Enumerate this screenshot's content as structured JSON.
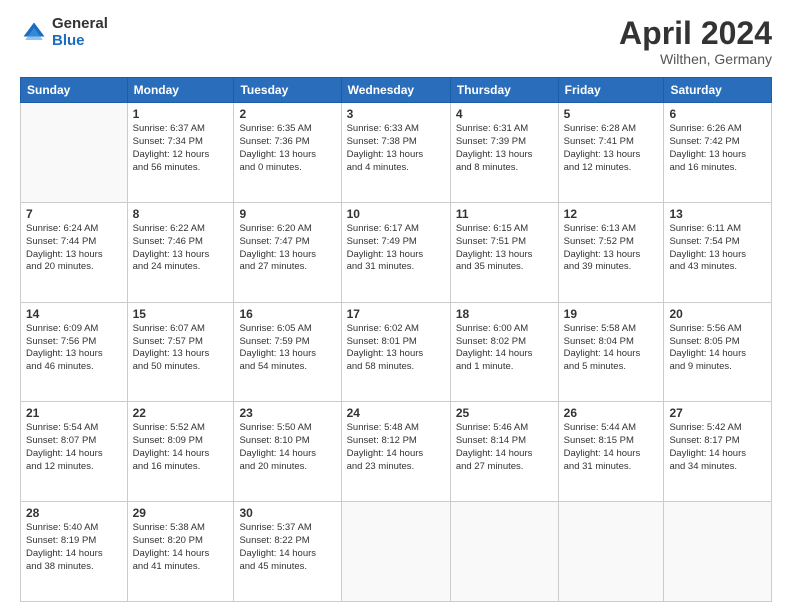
{
  "logo": {
    "general": "General",
    "blue": "Blue"
  },
  "title": "April 2024",
  "subtitle": "Wilthen, Germany",
  "days_of_week": [
    "Sunday",
    "Monday",
    "Tuesday",
    "Wednesday",
    "Thursday",
    "Friday",
    "Saturday"
  ],
  "weeks": [
    [
      {
        "day": "",
        "info": ""
      },
      {
        "day": "1",
        "info": "Sunrise: 6:37 AM\nSunset: 7:34 PM\nDaylight: 12 hours\nand 56 minutes."
      },
      {
        "day": "2",
        "info": "Sunrise: 6:35 AM\nSunset: 7:36 PM\nDaylight: 13 hours\nand 0 minutes."
      },
      {
        "day": "3",
        "info": "Sunrise: 6:33 AM\nSunset: 7:38 PM\nDaylight: 13 hours\nand 4 minutes."
      },
      {
        "day": "4",
        "info": "Sunrise: 6:31 AM\nSunset: 7:39 PM\nDaylight: 13 hours\nand 8 minutes."
      },
      {
        "day": "5",
        "info": "Sunrise: 6:28 AM\nSunset: 7:41 PM\nDaylight: 13 hours\nand 12 minutes."
      },
      {
        "day": "6",
        "info": "Sunrise: 6:26 AM\nSunset: 7:42 PM\nDaylight: 13 hours\nand 16 minutes."
      }
    ],
    [
      {
        "day": "7",
        "info": "Sunrise: 6:24 AM\nSunset: 7:44 PM\nDaylight: 13 hours\nand 20 minutes."
      },
      {
        "day": "8",
        "info": "Sunrise: 6:22 AM\nSunset: 7:46 PM\nDaylight: 13 hours\nand 24 minutes."
      },
      {
        "day": "9",
        "info": "Sunrise: 6:20 AM\nSunset: 7:47 PM\nDaylight: 13 hours\nand 27 minutes."
      },
      {
        "day": "10",
        "info": "Sunrise: 6:17 AM\nSunset: 7:49 PM\nDaylight: 13 hours\nand 31 minutes."
      },
      {
        "day": "11",
        "info": "Sunrise: 6:15 AM\nSunset: 7:51 PM\nDaylight: 13 hours\nand 35 minutes."
      },
      {
        "day": "12",
        "info": "Sunrise: 6:13 AM\nSunset: 7:52 PM\nDaylight: 13 hours\nand 39 minutes."
      },
      {
        "day": "13",
        "info": "Sunrise: 6:11 AM\nSunset: 7:54 PM\nDaylight: 13 hours\nand 43 minutes."
      }
    ],
    [
      {
        "day": "14",
        "info": "Sunrise: 6:09 AM\nSunset: 7:56 PM\nDaylight: 13 hours\nand 46 minutes."
      },
      {
        "day": "15",
        "info": "Sunrise: 6:07 AM\nSunset: 7:57 PM\nDaylight: 13 hours\nand 50 minutes."
      },
      {
        "day": "16",
        "info": "Sunrise: 6:05 AM\nSunset: 7:59 PM\nDaylight: 13 hours\nand 54 minutes."
      },
      {
        "day": "17",
        "info": "Sunrise: 6:02 AM\nSunset: 8:01 PM\nDaylight: 13 hours\nand 58 minutes."
      },
      {
        "day": "18",
        "info": "Sunrise: 6:00 AM\nSunset: 8:02 PM\nDaylight: 14 hours\nand 1 minute."
      },
      {
        "day": "19",
        "info": "Sunrise: 5:58 AM\nSunset: 8:04 PM\nDaylight: 14 hours\nand 5 minutes."
      },
      {
        "day": "20",
        "info": "Sunrise: 5:56 AM\nSunset: 8:05 PM\nDaylight: 14 hours\nand 9 minutes."
      }
    ],
    [
      {
        "day": "21",
        "info": "Sunrise: 5:54 AM\nSunset: 8:07 PM\nDaylight: 14 hours\nand 12 minutes."
      },
      {
        "day": "22",
        "info": "Sunrise: 5:52 AM\nSunset: 8:09 PM\nDaylight: 14 hours\nand 16 minutes."
      },
      {
        "day": "23",
        "info": "Sunrise: 5:50 AM\nSunset: 8:10 PM\nDaylight: 14 hours\nand 20 minutes."
      },
      {
        "day": "24",
        "info": "Sunrise: 5:48 AM\nSunset: 8:12 PM\nDaylight: 14 hours\nand 23 minutes."
      },
      {
        "day": "25",
        "info": "Sunrise: 5:46 AM\nSunset: 8:14 PM\nDaylight: 14 hours\nand 27 minutes."
      },
      {
        "day": "26",
        "info": "Sunrise: 5:44 AM\nSunset: 8:15 PM\nDaylight: 14 hours\nand 31 minutes."
      },
      {
        "day": "27",
        "info": "Sunrise: 5:42 AM\nSunset: 8:17 PM\nDaylight: 14 hours\nand 34 minutes."
      }
    ],
    [
      {
        "day": "28",
        "info": "Sunrise: 5:40 AM\nSunset: 8:19 PM\nDaylight: 14 hours\nand 38 minutes."
      },
      {
        "day": "29",
        "info": "Sunrise: 5:38 AM\nSunset: 8:20 PM\nDaylight: 14 hours\nand 41 minutes."
      },
      {
        "day": "30",
        "info": "Sunrise: 5:37 AM\nSunset: 8:22 PM\nDaylight: 14 hours\nand 45 minutes."
      },
      {
        "day": "",
        "info": ""
      },
      {
        "day": "",
        "info": ""
      },
      {
        "day": "",
        "info": ""
      },
      {
        "day": "",
        "info": ""
      }
    ]
  ]
}
